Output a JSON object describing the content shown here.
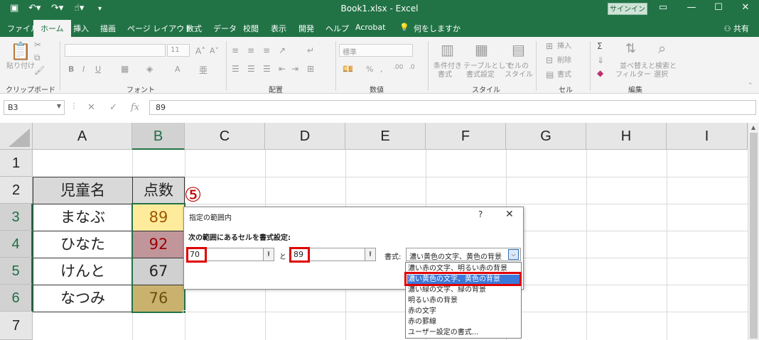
{
  "titlebar": {
    "filename": "Book1.xlsx",
    "separator": "-",
    "app": "Excel",
    "signin": "サインイン",
    "minimize_glyph": "—",
    "maximize_glyph": "☐",
    "close_glyph": "✕"
  },
  "ribbon_tabs": [
    "ファイル",
    "ホーム",
    "挿入",
    "描画",
    "ページ レイアウト",
    "数式",
    "データ",
    "校閲",
    "表示",
    "開発",
    "ヘルプ",
    "Acrobat",
    "何をしますか"
  ],
  "share_label": "共有",
  "ribbon": {
    "groups": [
      "クリップボード",
      "フォント",
      "配置",
      "数値",
      "スタイル",
      "セル",
      "編集"
    ],
    "paste": "貼り付け",
    "font_size": "11",
    "number_format": "標準",
    "cond_format": [
      "条件付き",
      "書式"
    ],
    "table_format": [
      "テーブルとして",
      "書式設定"
    ],
    "cell_style": [
      "セルの",
      "スタイル"
    ],
    "insert": "挿入",
    "delete": "削除",
    "format": "書式",
    "sort_filter": [
      "並べ替えと",
      "フィルター"
    ],
    "find_select": [
      "検索と",
      "選択"
    ]
  },
  "formula_bar": {
    "name_box": "B3",
    "fx": "fx",
    "value": "89"
  },
  "sheet": {
    "columns": [
      "A",
      "B",
      "C",
      "D",
      "E",
      "F",
      "G",
      "H",
      "I"
    ],
    "rows": [
      "1",
      "2",
      "3",
      "4",
      "5",
      "6",
      "7"
    ],
    "header_name": "児童名",
    "header_score": "点数",
    "records": [
      {
        "name": "まなぶ",
        "score": "89"
      },
      {
        "name": "ひなた",
        "score": "92"
      },
      {
        "name": "けんと",
        "score": "67"
      },
      {
        "name": "なつみ",
        "score": "76"
      }
    ]
  },
  "step_marker": "⑤",
  "dialog": {
    "title": "指定の範囲内",
    "help": "?",
    "close": "✕",
    "prompt": "次の範囲にあるセルを書式設定:",
    "from_value": "70",
    "and_label": "と",
    "to_value": "89",
    "format_label": "書式:",
    "format_selected": "濃い黄色の文字、黄色の背景",
    "options": [
      "濃い赤の文字、明るい赤の背景",
      "濃い黄色の文字、黄色の背景",
      "濃い緑の文字、緑の背景",
      "明るい赤の背景",
      "赤の文字",
      "赤の罫線",
      "ユーザー設定の書式..."
    ]
  },
  "colors": {
    "excel_green": "#217346",
    "highlight_red": "#e00000",
    "yellow_fill": "#ffeb9c",
    "yellow_text": "#9c5700",
    "red_fill": "#c0969a",
    "red_text": "#9c0006",
    "gray_fill": "#d0d0d0",
    "gold_fill": "#c8b26e"
  }
}
